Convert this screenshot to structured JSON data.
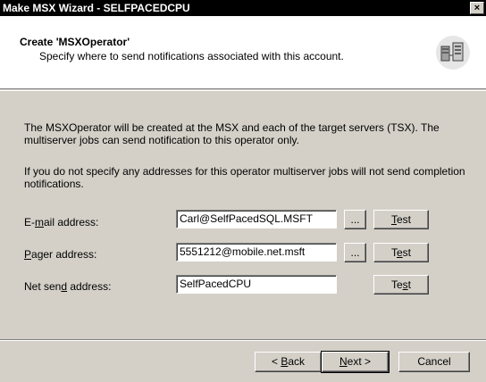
{
  "window": {
    "title": "Make MSX Wizard - SELFPACEDCPU",
    "close_glyph": "×"
  },
  "header": {
    "title": "Create 'MSXOperator'",
    "subtitle": "Specify where to send notifications associated with this account.",
    "icon": "server-network-icon"
  },
  "body": {
    "para1": "The MSXOperator will be created at the MSX and each of the target servers (TSX). The multiserver jobs can send notification to this operator only.",
    "para2": "If you do not specify any addresses for this operator multiserver jobs will not send completion notifications."
  },
  "fields": {
    "email": {
      "label_pre": "E-",
      "label_key": "m",
      "label_post": "ail address:",
      "value": "Carl@SelfPacedSQL.MSFT"
    },
    "pager": {
      "label_pre": "",
      "label_key": "P",
      "label_post": "ager address:",
      "value": "5551212@mobile.net.msft"
    },
    "netsend": {
      "label_pre": "Net sen",
      "label_key": "d",
      "label_post": " address:",
      "value": "SelfPacedCPU"
    }
  },
  "buttons": {
    "browse": "...",
    "test1": {
      "pre": "",
      "key": "T",
      "post": "est"
    },
    "test2": {
      "pre": "T",
      "key": "e",
      "post": "st"
    },
    "test3": {
      "pre": "Te",
      "key": "s",
      "post": "t"
    },
    "back": {
      "pre": "< ",
      "key": "B",
      "post": "ack"
    },
    "next": {
      "pre": "",
      "key": "N",
      "post": "ext >"
    },
    "cancel": "Cancel"
  }
}
